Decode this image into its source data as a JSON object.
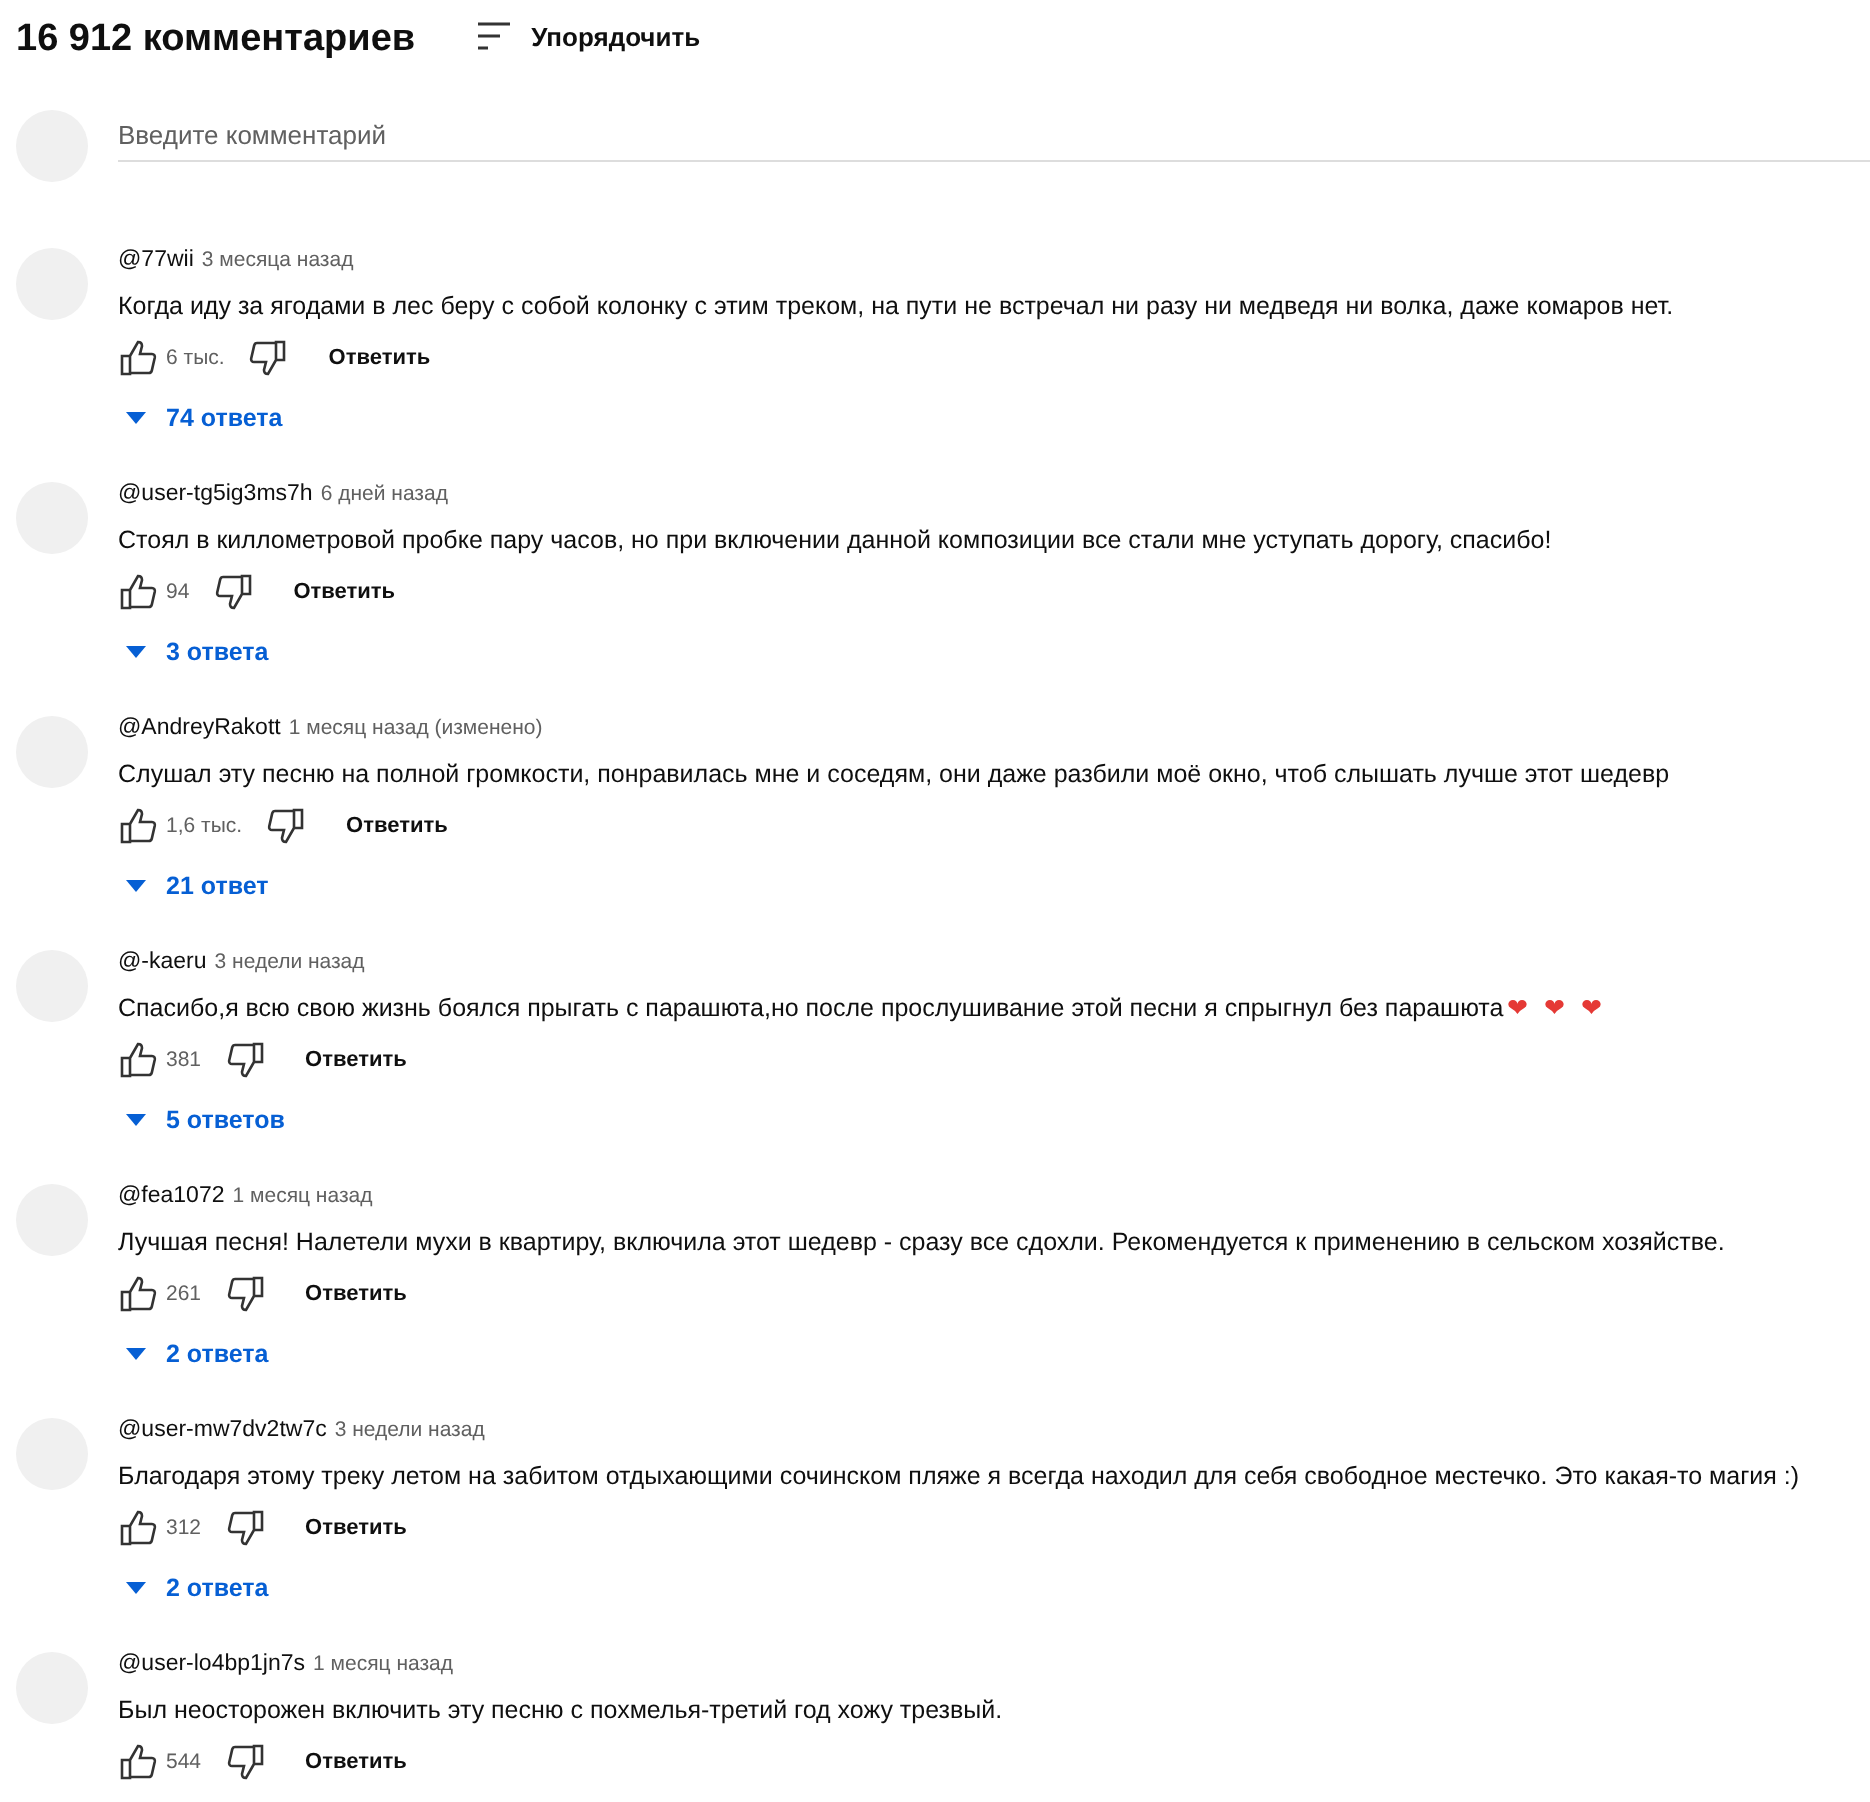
{
  "header": {
    "count": "16 912 комментариев",
    "sort_label": "Упорядочить"
  },
  "comment_box": {
    "placeholder": "Введите комментарий"
  },
  "comments": [
    {
      "author": "@77wii",
      "time": "3 месяца назад",
      "text": "Когда иду за ягодами в лес беру с собой колонку с этим треком, на пути не встречал ни разу ни медведя ни волка, даже комаров нет.",
      "likes": "6 тыс.",
      "reply": "Ответить",
      "replies": "74 ответа"
    },
    {
      "author": "@user-tg5ig3ms7h",
      "time": "6 дней назад",
      "text": "Стоял в киллометровой пробке пару часов, но при включении данной композиции все стали мне уступать дорогу, спасибо!",
      "likes": "94",
      "reply": "Ответить",
      "replies": "3 ответа"
    },
    {
      "author": "@AndreyRakott",
      "time": "1 месяц назад (изменено)",
      "text": "Слушал эту песню на полной громкости, понравилась мне и соседям, они даже разбили моё окно, чтоб слышать лучше этот шедевр",
      "likes": "1,6 тыс.",
      "reply": "Ответить",
      "replies": "21 ответ"
    },
    {
      "author": "@-kaeru",
      "time": "3 недели назад",
      "text": "Спасибо,я всю свою жизнь боялся прыгать с парашюта,но после прослушивание этой песни я спрыгнул без парашюта",
      "emoji": "❤ ❤ ❤",
      "likes": "381",
      "reply": "Ответить",
      "replies": "5 ответов"
    },
    {
      "author": "@fea1072",
      "time": "1 месяц назад",
      "text": "Лучшая песня! Налетели мухи в квартиру, включила этот шедевр - сразу все сдохли. Рекомендуется к применению в сельском хозяйстве.",
      "likes": "261",
      "reply": "Ответить",
      "replies": "2 ответа"
    },
    {
      "author": "@user-mw7dv2tw7c",
      "time": "3 недели назад",
      "text": "Благодаря этому треку летом на забитом отдыхающими сочинском пляже я всегда находил для себя свободное местечко. Это какая-то магия :)",
      "likes": "312",
      "reply": "Ответить",
      "replies": "2 ответа"
    },
    {
      "author": "@user-lo4bp1jn7s",
      "time": "1 месяц назад",
      "text": "Был неосторожен включить эту песню с похмелья-третий год хожу трезвый.",
      "likes": "544",
      "reply": "Ответить"
    }
  ]
}
